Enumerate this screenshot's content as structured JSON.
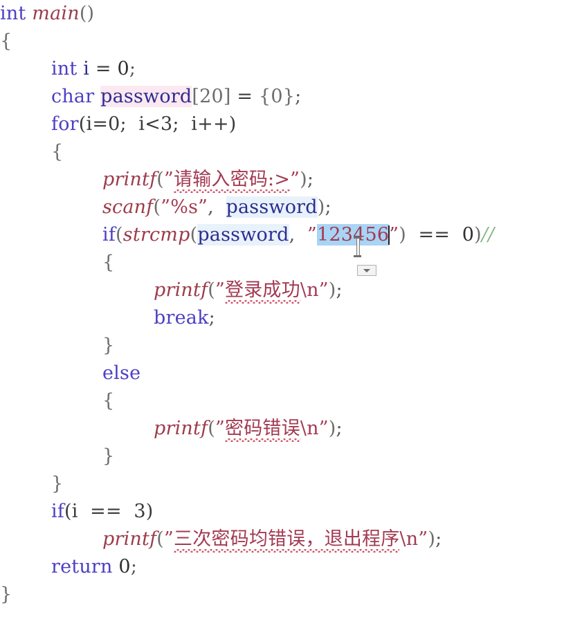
{
  "editor": {
    "language": "C",
    "background_color": "#ffffff",
    "colors": {
      "keyword": "#4b3fc4",
      "function": "#9c3b4a",
      "identifier": "#2d2d8f",
      "string": "#a33a52",
      "comment": "#86b686",
      "selection": "#a8d4f5",
      "declaration_highlight": "#fbe8f0",
      "reference_highlight": "#e8f2fb",
      "spellcheck_squiggle": "#c94b5e"
    }
  },
  "code": {
    "line_01": {
      "kw_int": "int",
      "fn_main": "main",
      "parens": "()"
    },
    "line_02": {
      "brace": "{"
    },
    "line_03": {
      "kw": "int",
      "ident": "i",
      "op": " = ",
      "num": "0",
      "semi": ";"
    },
    "line_04": {
      "kw": "char",
      "ident": "password",
      "array": "[20]",
      "op": " = ",
      "init": "{0}",
      "semi": ";"
    },
    "line_05": {
      "kw": "for",
      "expr": "(i=0;  i<3;  i++)"
    },
    "line_06": {
      "brace": "{"
    },
    "line_07": {
      "fn": "printf",
      "open": "(",
      "quote": "”",
      "text": "请输入密码:>",
      "quote2": "”",
      "close": ")",
      "semi": ";"
    },
    "line_08": {
      "fn": "scanf",
      "open": "(",
      "quote": "”",
      "fmt": "%s",
      "quote2": "”",
      "comma": ",  ",
      "ident": "password",
      "close": ")",
      "semi": ";"
    },
    "line_09": {
      "kw_if": "if",
      "open": "(",
      "fn_strcmp": "strcmp",
      "open2": "(",
      "ident": "password",
      "comma": ",  ",
      "quote": "”",
      "selected_text": "123456",
      "quote2": "”",
      "close2": ")",
      "op": "  ==  ",
      "num": "0",
      "close": ")",
      "comment": "//"
    },
    "line_10": {
      "brace": "{"
    },
    "line_11": {
      "fn": "printf",
      "open": "(",
      "quote": "”",
      "text": "登录成功",
      "escape": "\\n",
      "quote2": "”",
      "close": ")",
      "semi": ";"
    },
    "line_12": {
      "kw": "break",
      "semi": ";"
    },
    "line_13": {
      "brace": "}"
    },
    "line_14": {
      "kw": "else"
    },
    "line_15": {
      "brace": "{"
    },
    "line_16": {
      "fn": "printf",
      "open": "(",
      "quote": "”",
      "text": "密码错误",
      "escape": "\\n",
      "quote2": "”",
      "close": ")",
      "semi": ";"
    },
    "line_17": {
      "brace": "}"
    },
    "line_18": {
      "brace": "}"
    },
    "line_19": {
      "kw": "if",
      "expr": "(i  ==  3)"
    },
    "line_20": {
      "fn": "printf",
      "open": "(",
      "quote": "”",
      "text": "三次密码均错误，退出程序",
      "escape": "\\n",
      "quote2": "”",
      "close": ")",
      "semi": ";"
    },
    "line_21": {
      "kw": "return",
      "num": "0",
      "semi": ";"
    },
    "line_22": {
      "brace": "}"
    }
  },
  "selection": {
    "selected_text": "123456",
    "has_caret": true,
    "caret_position": "after-selection"
  },
  "smart_tag": {
    "icon": "chevron-down-icon",
    "tooltip": ""
  },
  "mouse_cursor": {
    "icon": "text-ibeam-cursor"
  },
  "spellcheck_underlined_strings": [
    "请输入密码:>",
    "登录成功",
    "密码错误",
    "三次密码均错误，退出程序"
  ]
}
